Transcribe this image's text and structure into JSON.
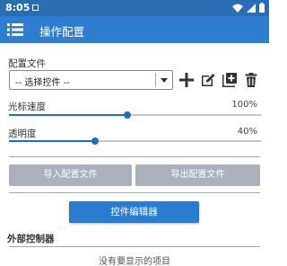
{
  "status_bar": {
    "time": "8:05"
  },
  "app_bar": {
    "title": "操作配置",
    "menu_icon": "menu-icon"
  },
  "config": {
    "label": "配置文件",
    "select_value": "-- 选择控件 --",
    "actions": [
      "add-icon",
      "edit-icon",
      "copy-icon",
      "delete-icon"
    ]
  },
  "cursor_speed": {
    "label": "光标速度",
    "value_text": "100%",
    "slider_fraction": 0.47
  },
  "opacity": {
    "label": "透明度",
    "value_text": "40%",
    "slider_fraction": 0.34
  },
  "buttons": {
    "import": "导入配置文件",
    "export": "导出配置文件",
    "editor": "控件编辑器"
  },
  "external": {
    "title": "外部控制器",
    "empty": "没有要显示的项目"
  },
  "colors": {
    "app_bar": "#2f7fd0",
    "status_bar": "#2a6db3",
    "accent": "#1f6fbf",
    "disabled_button": "#a8b1bd"
  }
}
